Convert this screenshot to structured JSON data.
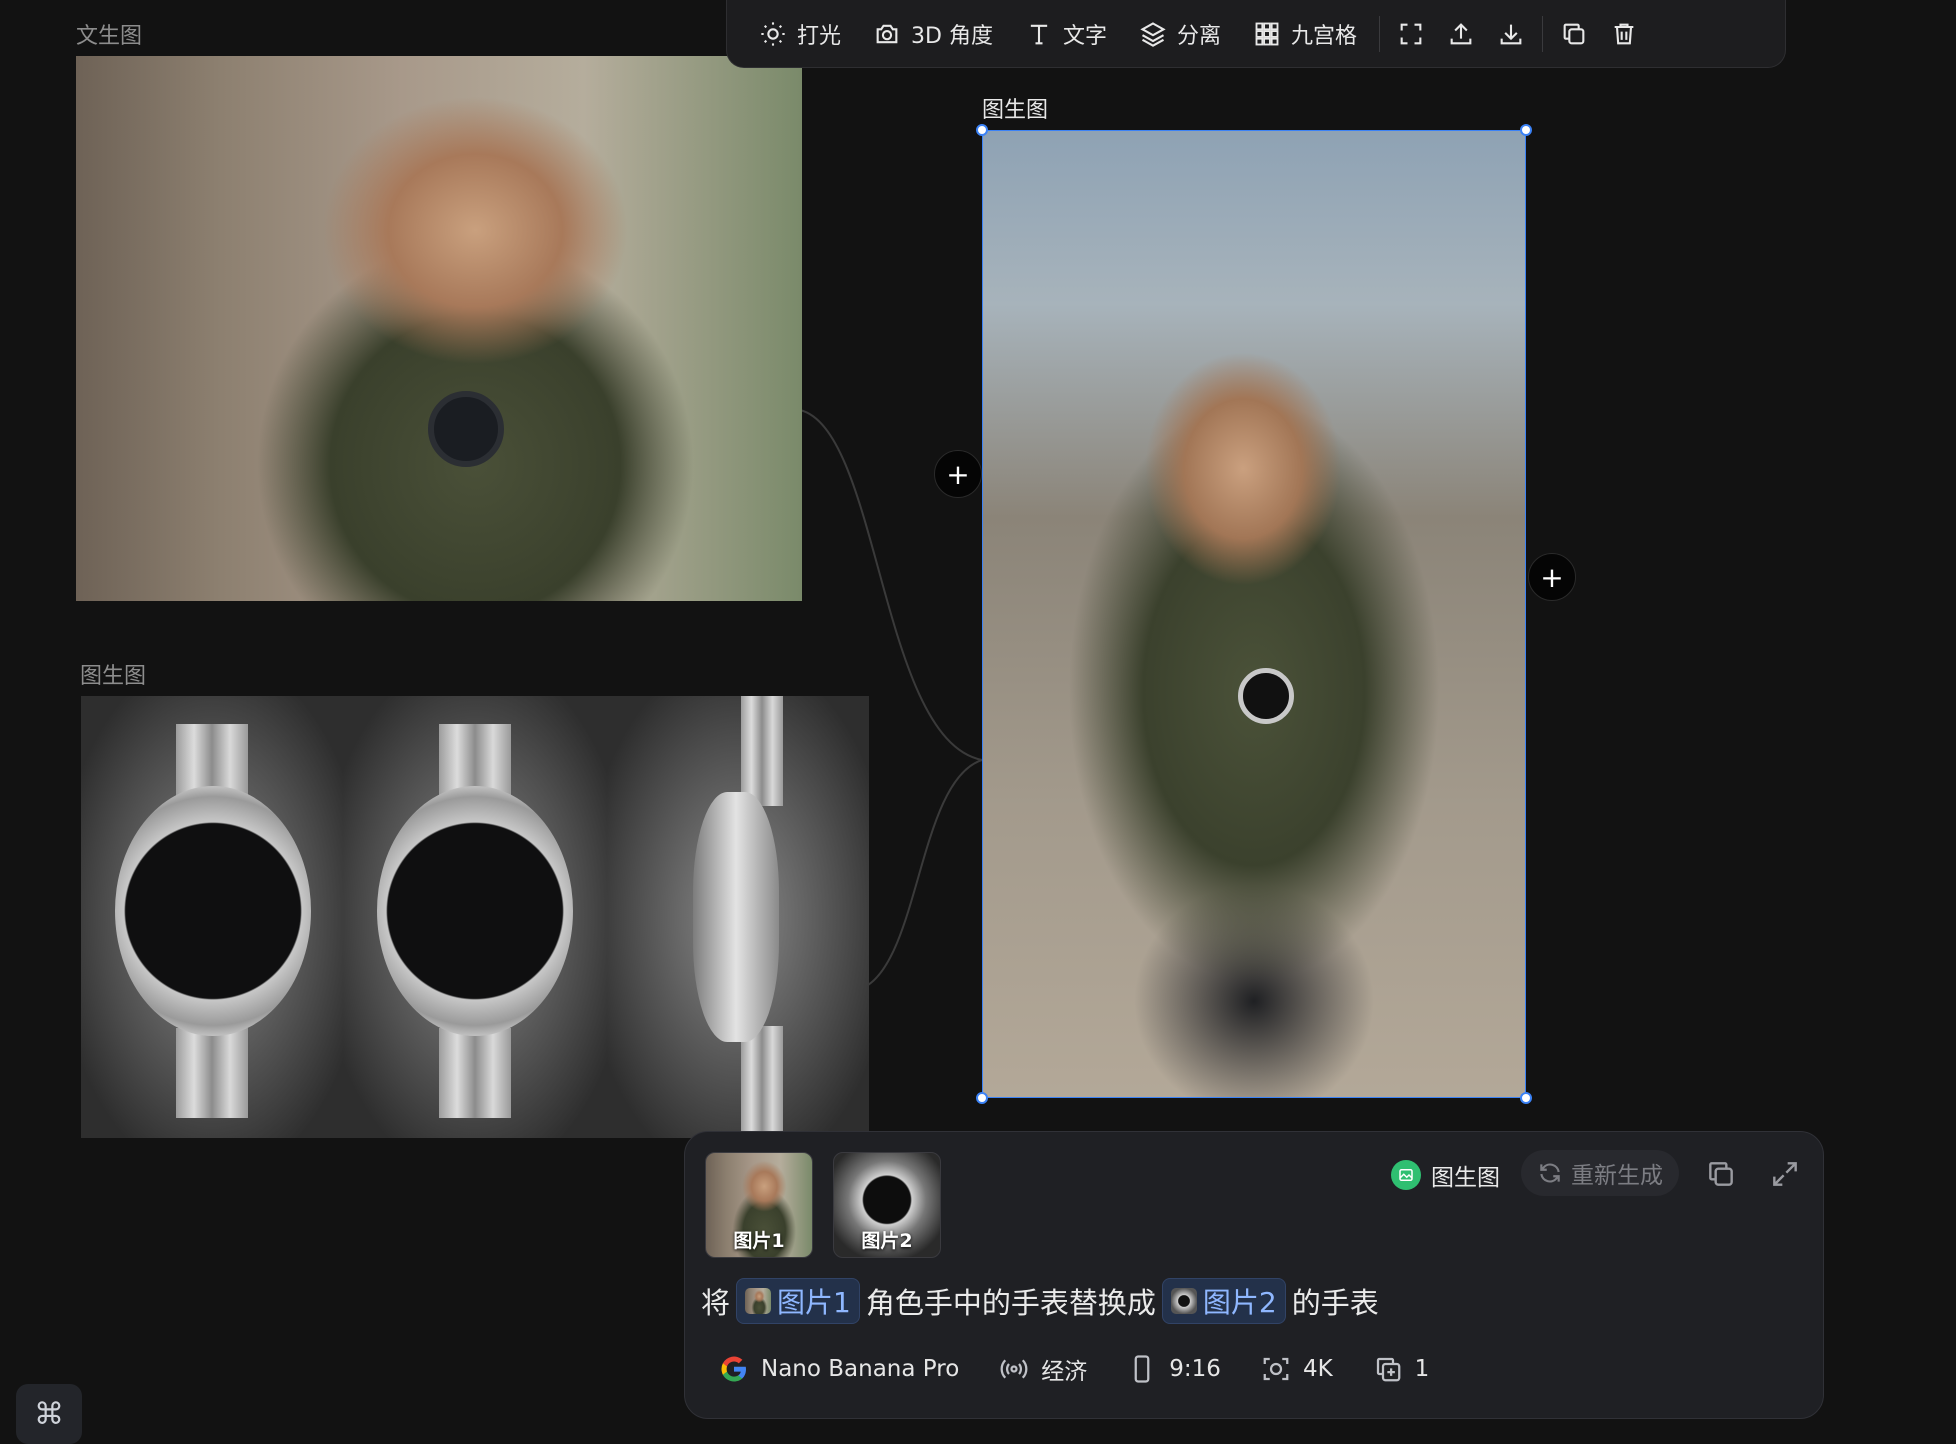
{
  "canvas": {
    "nodes": [
      {
        "label": "文生图"
      },
      {
        "label": "图生图"
      },
      {
        "label": "图生图"
      }
    ]
  },
  "toolbar": {
    "tools": [
      {
        "label": "打光",
        "icon": "sun-icon"
      },
      {
        "label": "3D 角度",
        "icon": "camera-icon"
      },
      {
        "label": "文字",
        "icon": "text-icon"
      },
      {
        "label": "分离",
        "icon": "layers-icon"
      },
      {
        "label": "九宫格",
        "icon": "grid-icon"
      }
    ],
    "actions": [
      "fullscreen-icon",
      "upload-icon",
      "download-icon",
      "copy-icon",
      "trash-icon"
    ]
  },
  "prompt_panel": {
    "references": [
      {
        "label": "图片1"
      },
      {
        "label": "图片2"
      }
    ],
    "mode": "图生图",
    "regenerate_label": "重新生成",
    "prompt": {
      "prefix": "将",
      "ref1": "图片1",
      "middle": "角色手中的手表替换成",
      "ref2": "图片2",
      "suffix": "的手表"
    },
    "settings": {
      "model": "Nano Banana Pro",
      "speed": "经济",
      "ratio": "9:16",
      "resolution": "4K",
      "count": "1"
    }
  },
  "colors": {
    "background": "#121212",
    "accent_blue": "#3b82f6",
    "mode_green": "#2fbf71",
    "chip_text": "#8fb7ff"
  }
}
